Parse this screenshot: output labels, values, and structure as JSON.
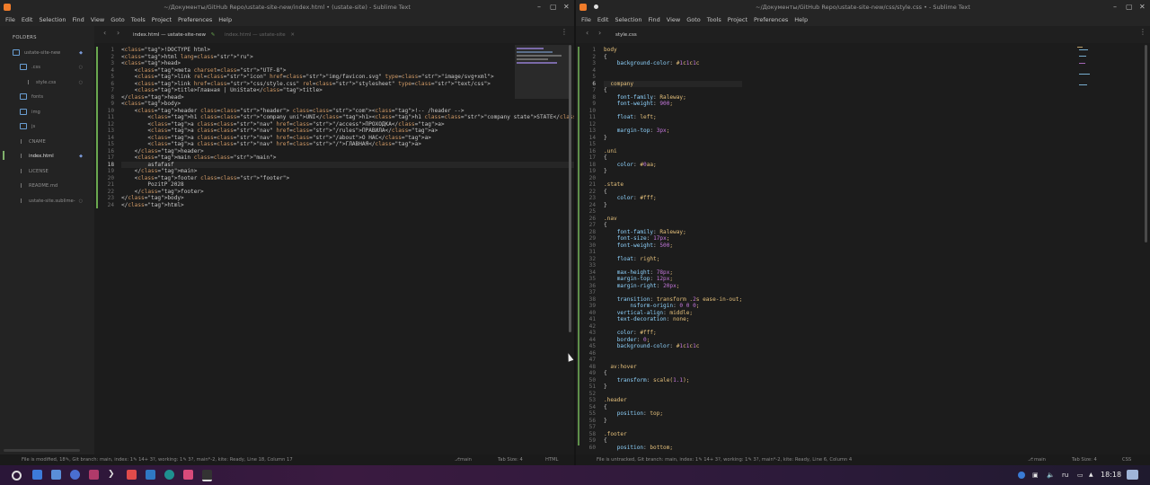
{
  "left_window": {
    "title": "~/Документы/GitHub Repo/ustate-site-new/index.html • (ustate-site) - Sublime Text",
    "menu": [
      "File",
      "Edit",
      "Selection",
      "Find",
      "View",
      "Goto",
      "Tools",
      "Project",
      "Preferences",
      "Help"
    ],
    "sidebar": {
      "header": "FOLDERS",
      "items": [
        {
          "label": "ustate-site-new",
          "type": "folder"
        },
        {
          "label": ".css",
          "type": "folder"
        },
        {
          "label": "style.css",
          "type": "file"
        },
        {
          "label": "fonts",
          "type": "folder"
        },
        {
          "label": "img",
          "type": "folder"
        },
        {
          "label": "js",
          "type": "folder"
        },
        {
          "label": "CNAME",
          "type": "file"
        },
        {
          "label": "index.html",
          "type": "file"
        },
        {
          "label": "LICENSE",
          "type": "file"
        },
        {
          "label": "README.md",
          "type": "file"
        },
        {
          "label": "ustate-site.sublime-",
          "type": "file"
        }
      ]
    },
    "tabs": [
      {
        "label": "index.html — ustate-site-new",
        "active": true
      },
      {
        "label": "index.html — ustate-site",
        "active": false
      }
    ],
    "code_lines": [
      "<!DOCTYPE html>",
      "<html lang=\"ru\">",
      "<head>",
      "    <meta charset=\"UTF-8\">",
      "    <link rel=\"icon\" href=\"img/favicon.svg\" type=\"image/svg+xml\">",
      "    <link href=\"css/style.css\" rel=\"stylesheet\" type=\"text/css\">",
      "    <title>Главная | UniState</title>",
      "</head>",
      "<body>",
      "    <header class=\"header\"> <!-- /header -->",
      "        <h1 class=\"company uni\">UNI</h1><h1 class=\"company state\">STATE</h1>",
      "        <a class=\"nav\" href=\"/access\">ПРОХОДКА</a>",
      "        <a class=\"nav\" href=\"/rules\">ПРАВИЛА</a>",
      "        <a class=\"nav\" href=\"/about\">О НАС</a>",
      "        <a class=\"nav\" href=\"/\">ГЛАВНАЯ</a>",
      "    </header>",
      "    <main class=\"main\">",
      "        asfafasf",
      "    </main>",
      "    <footer class=\"footer\">",
      "        PozitP 2028",
      "    </footer>",
      "</body>",
      "</html>"
    ],
    "status": {
      "left": "File is modified, 18✎, Git branch: main, index: 1✎ 14+ 3?, working: 1✎ 3?, main*-2, kite: Ready, Line 18, Column 17",
      "branch": "main",
      "tab_size": "Tab Size: 4",
      "syntax": "HTML"
    }
  },
  "right_window": {
    "title": "~/Документы/GitHub Repo/ustate-site-new/css/style.css • - Sublime Text",
    "menu": [
      "File",
      "Edit",
      "Selection",
      "Find",
      "View",
      "Goto",
      "Tools",
      "Project",
      "Preferences",
      "Help"
    ],
    "tab": {
      "label": "style.css",
      "active": true
    },
    "code_lines": [
      "body",
      "{",
      "    background-color: #1c1c1c",
      "",
      "",
      "  company",
      "{",
      "    font-family: Raleway;",
      "    font-weight: 900;",
      "",
      "    float: left;",
      "",
      "    margin-top: 3px;",
      "}",
      "",
      ".uni",
      "{",
      "    color: #0aa;",
      "}",
      "",
      ".state",
      "{",
      "    color: #fff;",
      "}",
      "",
      ".nav",
      "{",
      "    font-family: Raleway;",
      "    font-size: 17px;",
      "    font-weight: 500;",
      "",
      "    float: right;",
      "",
      "    max-height: 78px;",
      "    margin-top: 12px;",
      "    margin-right: 20px;",
      "",
      "    transition: transform .2s ease-in-out;",
      "        nsform-origin: 0 0 0;",
      "    vertical-align: middle;",
      "    text-decoration: none;",
      "",
      "    color: #fff;",
      "    border: 0;",
      "    background-color: #1c1c1c",
      "",
      "",
      "  av:hover",
      "{",
      "    transform: scale(1.1);",
      "}",
      "",
      ".header",
      "{",
      "    position: top;",
      "}",
      "",
      ".footer",
      "{",
      "    position: bottom;"
    ],
    "status": {
      "left": "File is untracked, Git branch: main, index: 1✎ 14+ 3?, working: 1✎ 3?, main*-2, kite: Ready, Line 6, Column 4",
      "branch": "main",
      "tab_size": "Tab Size: 4",
      "syntax": "CSS"
    }
  },
  "taskbar": {
    "tray": {
      "lang": "ru",
      "time": "18:18"
    }
  },
  "colors": {
    "accent": "#6aa84f",
    "editor_bg": "#1c1c1c",
    "sidebar_bg": "#232323"
  }
}
